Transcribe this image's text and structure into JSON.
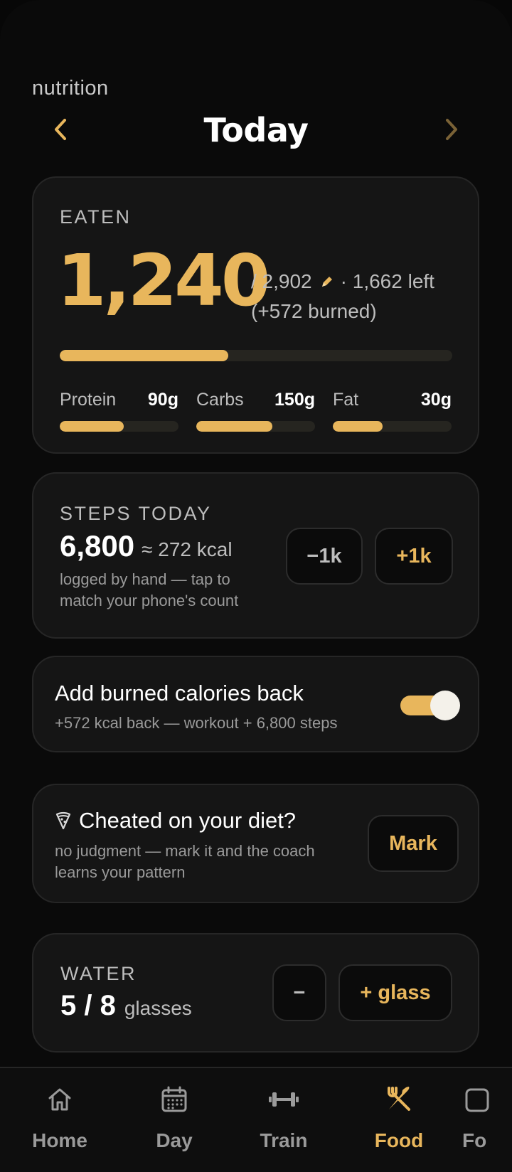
{
  "header": {
    "eyebrow": "nutrition",
    "title": "Today",
    "prev_icon": "chevron-left-icon",
    "next_icon": "chevron-right-icon"
  },
  "eaten": {
    "label": "EATEN",
    "value": "1,240",
    "goal": "/ 2,902",
    "edit_icon": "pencil-icon",
    "left": "· 1,662 left",
    "burned": "(+572 burned)",
    "progress": 0.43,
    "macros": [
      {
        "name": "Protein",
        "amount": "90g",
        "progress": 0.54
      },
      {
        "name": "Carbs",
        "amount": "150g",
        "progress": 0.64
      },
      {
        "name": "Fat",
        "amount": "30g",
        "progress": 0.42
      }
    ]
  },
  "steps": {
    "label": "STEPS TODAY",
    "value": "6,800",
    "kcal": "≈ 272 kcal",
    "note": "logged by hand — tap to match your phone's count",
    "minus_label": "−1k",
    "plus_label": "+1k"
  },
  "burned_toggle": {
    "title": "Add burned calories back",
    "subtitle": "+572 kcal back — workout + 6,800 steps",
    "enabled": true
  },
  "cheat": {
    "icon": "pizza-slice-icon",
    "title": "Cheated on your diet?",
    "subtitle": "no judgment — mark it and the coach learns your pattern",
    "button_label": "Mark"
  },
  "water": {
    "label": "WATER",
    "value": "5 / 8",
    "unit": "glasses",
    "minus_label": "−",
    "plus_label": "+ glass"
  },
  "tabs": [
    {
      "label": "Home",
      "icon": "home-icon",
      "active": false
    },
    {
      "label": "Day",
      "icon": "calendar-icon",
      "active": false
    },
    {
      "label": "Train",
      "icon": "dumbbell-icon",
      "active": false
    },
    {
      "label": "Food",
      "icon": "fork-knife-icon",
      "active": true
    },
    {
      "label": "Fo",
      "icon": "partial-tab-icon",
      "active": false
    }
  ],
  "colors": {
    "accent": "#e8b65c",
    "background": "#0a0a0a",
    "card": "#151515",
    "muted": "#9a9a9a"
  }
}
